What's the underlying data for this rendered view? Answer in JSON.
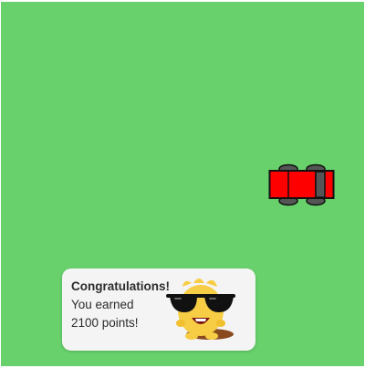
{
  "game": {
    "colors": {
      "field": "#68d16c",
      "car_body": "#ff0000",
      "car_outline": "#111111",
      "wheel": "#555555",
      "toast_bg": "#f4f4f4",
      "mascot_body": "#f7cd45",
      "sunglasses": "#111111"
    },
    "player": {
      "icon": "red-car-icon",
      "heading": "right"
    }
  },
  "toast": {
    "title": "Congratulations!",
    "line1": "You earned",
    "line2": "2100 points!",
    "mascot_icon": "sunglasses-mascot-icon"
  }
}
